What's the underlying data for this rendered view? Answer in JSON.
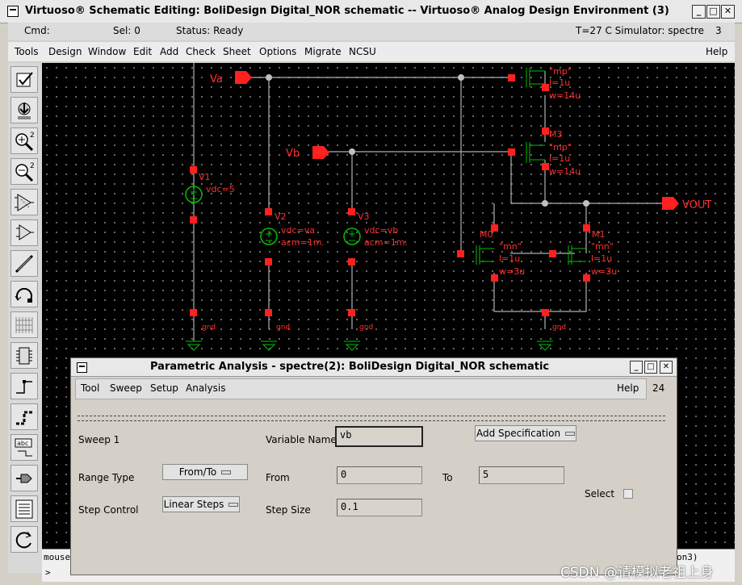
{
  "window": {
    "title": "Virtuoso® Schematic Editing: BoliDesign Digital_NOR schematic -- Virtuoso® Analog Design Environment (3)",
    "controls": {
      "minimize": "_",
      "maximize": "□",
      "close": "✕"
    }
  },
  "status": {
    "cmd": "Cmd:",
    "sel": "Sel: 0",
    "status": "Status: Ready",
    "temp_sim": "T=27 C   Simulator: spectre",
    "number": "3"
  },
  "menu": [
    "Tools",
    "Design",
    "Window",
    "Edit",
    "Add",
    "Check",
    "Sheet",
    "Options",
    "Migrate",
    "NCSU"
  ],
  "menu_help": "Help",
  "toolbar_icons": [
    "check-icon",
    "descend-icon",
    "zoom-in-icon",
    "zoom-out-icon",
    "stretch-icon",
    "copy-icon",
    "wire-icon",
    "undo-icon",
    "grid-icon",
    "instance-icon",
    "wire-narrow-icon",
    "bus-icon",
    "label-icon",
    "pin-icon",
    "property-icon",
    "refresh-icon"
  ],
  "toolbar_labels": {
    "zoom_in": "2",
    "zoom_out": "2",
    "label": "abc"
  },
  "schematic": {
    "colors": {
      "wire": "#b0b0b0",
      "pin": "#ff2020",
      "device": "#00c000",
      "text": "#ff3030"
    },
    "pins": {
      "va": "Va",
      "vb": "Vb",
      "vout": "VOUT"
    },
    "sources": [
      {
        "name": "V1",
        "params": [
          "vdc=5"
        ],
        "gnd": "gnd"
      },
      {
        "name": "V2",
        "params": [
          "vdc=va",
          "acm=1m."
        ],
        "gnd": "gnd"
      },
      {
        "name": "V3",
        "params": [
          "vdc=vb",
          "acm=1m."
        ],
        "gnd": "gnd"
      }
    ],
    "transistors": [
      {
        "name": "M2",
        "model": "\"mp\"",
        "l": "l=1u",
        "w": "w=14u"
      },
      {
        "name": "M3",
        "model": "\"mp\"",
        "l": "l=1u",
        "w": "w=14u"
      },
      {
        "name": "M0",
        "model": "\"mn\"",
        "l": "l=1u",
        "w": "w=3u"
      },
      {
        "name": "M1",
        "model": "\"mn\"",
        "l": "l=1u",
        "w": "w=3u"
      }
    ],
    "gnd_bottom": "gnd"
  },
  "cmdline": {
    "mouse": "mouse",
    "prompt": ">",
    "right_text": "on3)"
  },
  "dialog": {
    "title": "Parametric Analysis - spectre(2): BoliDesign Digital_NOR schematic",
    "menu": [
      "Tool",
      "Sweep",
      "Setup",
      "Analysis"
    ],
    "help": "Help",
    "number": "24",
    "sweep_label": "Sweep 1",
    "variable_name_label": "Variable Name",
    "variable_name_value": "vb",
    "add_spec_button": "Add Specification",
    "range_type_label": "Range Type",
    "range_type_value": "From/To",
    "from_label": "From",
    "from_value": "0",
    "to_label": "To",
    "to_value": "5",
    "select_label": "Select",
    "step_control_label": "Step Control",
    "step_control_value": "Linear Steps",
    "step_size_label": "Step Size",
    "step_size_value": "0.1"
  },
  "watermark": "CSDN @请模拟老祖上身"
}
